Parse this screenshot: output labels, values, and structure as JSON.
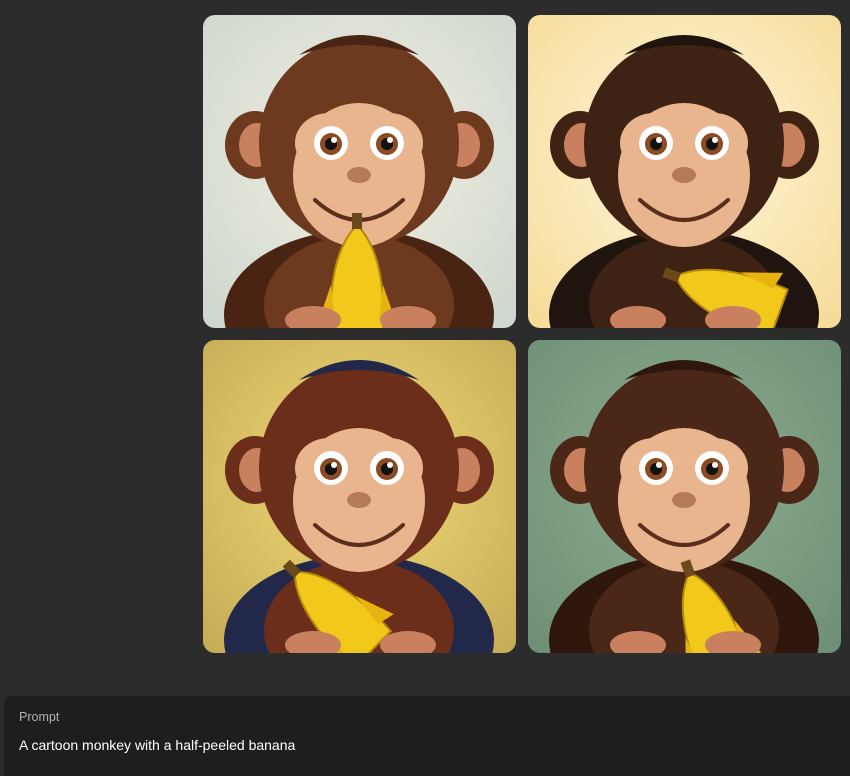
{
  "gallery": {
    "images": [
      {
        "subject": "cartoon-monkey-banana",
        "background": "#cfd8cf",
        "background_glow": "#f2efe0",
        "fur": "#6e3a1f",
        "fur_dark": "#4a2412"
      },
      {
        "subject": "cartoon-monkey-banana",
        "background": "#f6dc9a",
        "background_glow": "#fff7dc",
        "fur": "#3e2314",
        "fur_dark": "#1f140e"
      },
      {
        "subject": "cartoon-monkey-banana",
        "background": "#c7ad56",
        "background_glow": "#f1d978",
        "fur": "#6b2e1a",
        "fur_dark": "#22284a"
      },
      {
        "subject": "cartoon-monkey-banana",
        "background": "#6f9077",
        "background_glow": "#8fae92",
        "fur": "#4a2716",
        "fur_dark": "#2f170c"
      }
    ]
  },
  "prompt": {
    "label": "Prompt",
    "text": "A cartoon monkey with a half-peeled banana"
  },
  "colors": {
    "page_background": "#2c2c2c",
    "panel_background": "#1e1e1e",
    "banana": "#f2c81b",
    "face": "#e9b58e"
  }
}
